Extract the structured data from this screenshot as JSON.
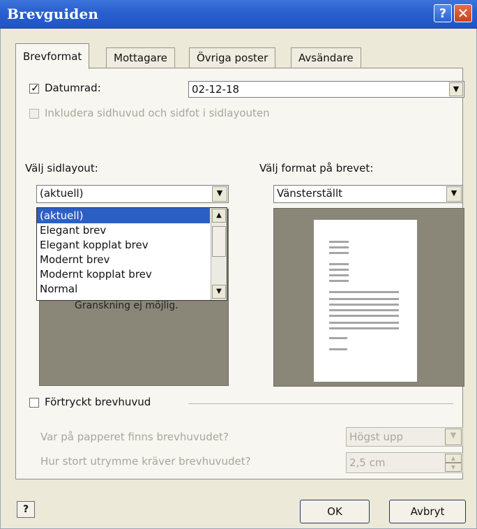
{
  "window": {
    "title": "Brevguiden",
    "help_glyph": "?",
    "close_glyph": "✕"
  },
  "tabs": [
    {
      "label": "Brevformat",
      "active": true
    },
    {
      "label": "Mottagare",
      "active": false
    },
    {
      "label": "Övriga poster",
      "active": false
    },
    {
      "label": "Avsändare",
      "active": false
    }
  ],
  "date_line": {
    "checkbox_label": "Datumrad:",
    "checked": true,
    "value": "02-12-18"
  },
  "include_header_footer": {
    "label": "Inkludera sidhuvud och sidfot i sidlayouten",
    "enabled": false
  },
  "page_layout": {
    "label": "Välj sidlayout:",
    "selected": "(aktuell)",
    "options": [
      "(aktuell)",
      "Elegant brev",
      "Elegant kopplat brev",
      "Modernt brev",
      "Modernt kopplat brev",
      "Normal"
    ],
    "preview_note": "Granskning ej möjlig."
  },
  "letter_format": {
    "label": "Välj format på brevet:",
    "selected": "Vänsterställt"
  },
  "preprinted": {
    "label": "Förtryckt brevhuvud",
    "checked": false
  },
  "letterhead_position": {
    "label": "Var på papperet finns brevhuvudet?",
    "value": "Högst upp"
  },
  "letterhead_space": {
    "label": "Hur stort utrymme kräver brevhuvudet?",
    "value": "2,5 cm"
  },
  "footer": {
    "help_glyph": "?",
    "ok_label": "OK",
    "cancel_label": "Avbryt"
  },
  "colors": {
    "titlebar": "#2a5fcf",
    "selection": "#2c5fc4",
    "preview_bg": "#8a8778"
  }
}
